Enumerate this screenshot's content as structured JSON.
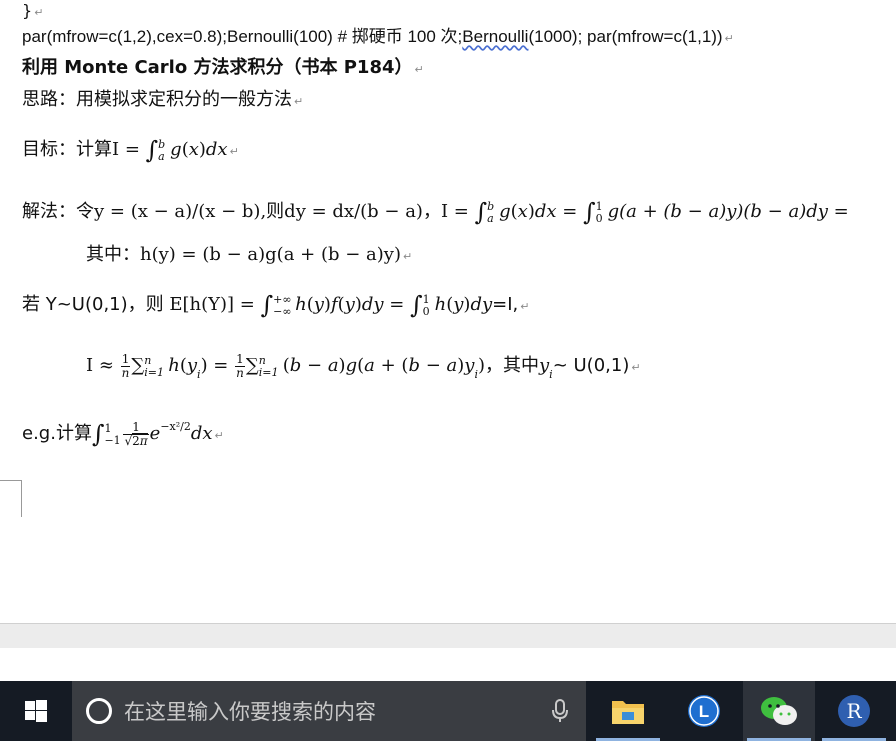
{
  "document": {
    "brace_line": "}",
    "code_line": {
      "before": "par(mfrow=c(1,2),cex=0.8);Bernoulli(100) # ",
      "comment": "掷硬币 100 次;",
      "misspelled": "Bernoulli",
      "after": "(1000); par(mfrow=c(1,1))"
    },
    "heading": "利用 Monte Carlo 方法求积分（书本 P184）",
    "idea": "思路：用模拟求定积分的一般方法",
    "goal_label": "目标：计算",
    "solution_label": "解法：令",
    "solution_tail": "g(a + (b − a)y)(b − a)dy =",
    "where_label": "其中：",
    "where_expr": "h(y) = (b − a)g(a + (b − a)y)",
    "if_label": "若 Y~U(0,1)，则",
    "if_result": "=I,",
    "approx_where": "，其中",
    "approx_dist": "~ U(0,1)",
    "eg_label": "e.g.计算"
  },
  "taskbar": {
    "search_placeholder": "在这里输入你要搜索的内容",
    "apps": [
      {
        "name": "file-explorer",
        "active": false
      },
      {
        "name": "l-app",
        "letter": "L",
        "active": false
      },
      {
        "name": "wechat",
        "active": true
      },
      {
        "name": "r-app",
        "letter": "R",
        "active": false
      }
    ]
  },
  "colors": {
    "taskbar_bg": "#151b24",
    "search_bg": "#3a3d42",
    "active_underline": "#8fb3e0",
    "l_app": "#1f6fd0",
    "r_app": "#2f5fb0",
    "wechat": "#3fbf3f",
    "folder": "#f2c14e"
  }
}
